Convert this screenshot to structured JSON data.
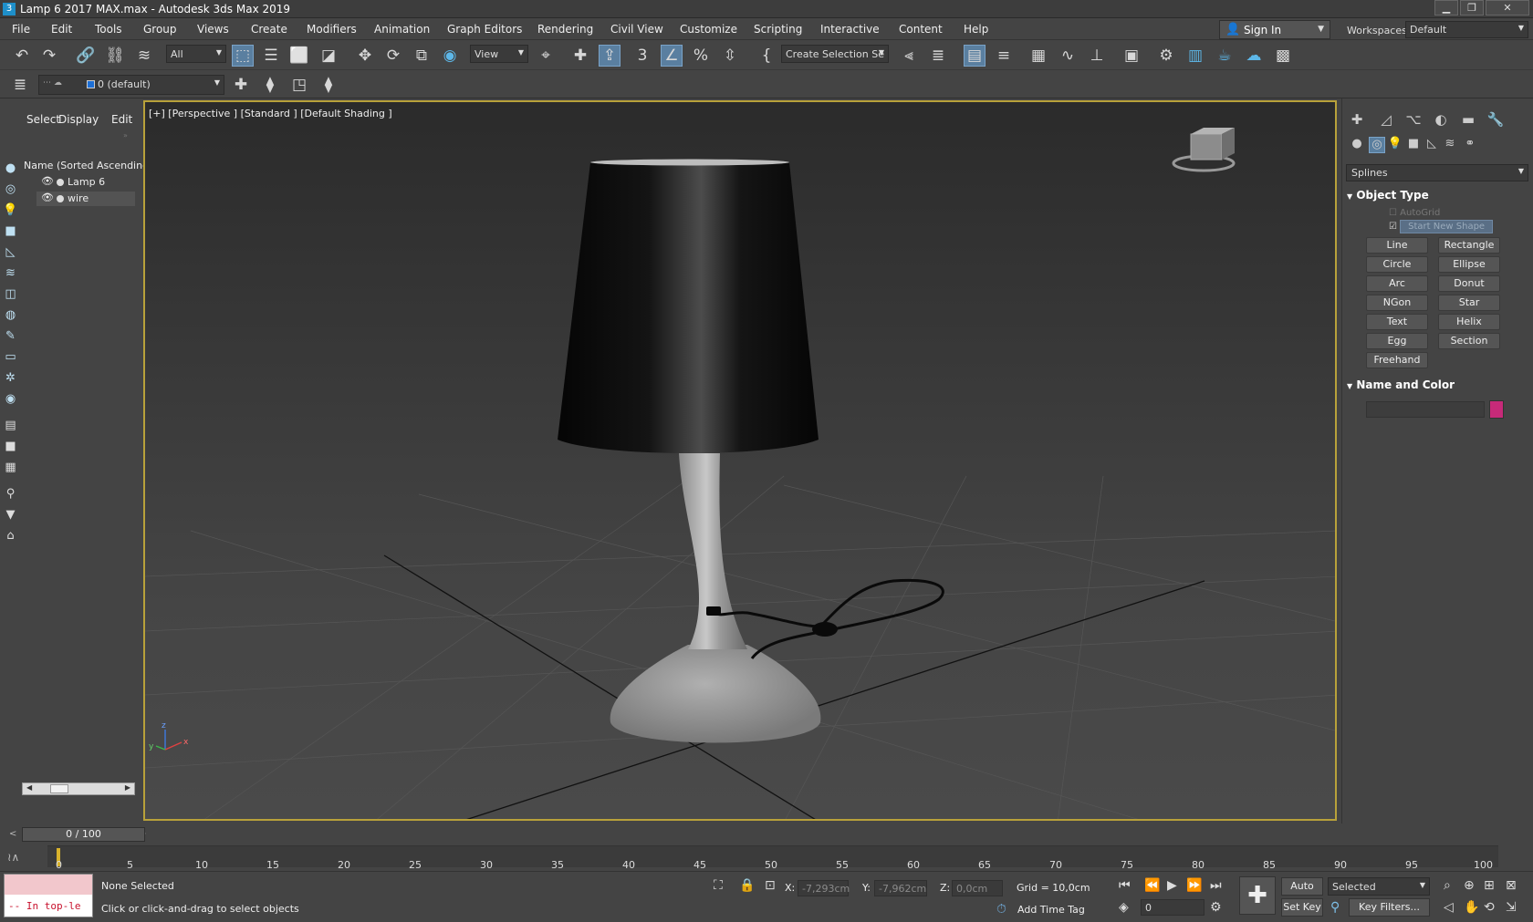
{
  "window": {
    "title": "Lamp 6 2017 MAX.max - Autodesk 3ds Max 2019",
    "app_icon": "3ds-max-icon",
    "controls": [
      "minimize",
      "restore",
      "close"
    ]
  },
  "menu": [
    "File",
    "Edit",
    "Tools",
    "Group",
    "Views",
    "Create",
    "Modifiers",
    "Animation",
    "Graph Editors",
    "Rendering",
    "Civil View",
    "Customize",
    "Scripting",
    "Interactive",
    "Content",
    "Help"
  ],
  "account": {
    "sign_in": "Sign In"
  },
  "workspaces": {
    "label": "Workspaces:",
    "value": "Default"
  },
  "toolbar": {
    "selection_filter": "All",
    "ref_coord": "View",
    "named_selection": "Create Selection Se"
  },
  "layer": {
    "current": "0 (default)"
  },
  "scene_explorer": {
    "tabs": [
      "Select",
      "Display",
      "Edit"
    ],
    "column_header": "Name (Sorted Ascending)",
    "items": [
      {
        "name": "Lamp 6"
      },
      {
        "name": "wire"
      }
    ]
  },
  "viewport": {
    "label": "[+] [Perspective ] [Standard ] [Default Shading ]",
    "border_color": "#b8a13a",
    "axis": [
      "z",
      "x",
      "y"
    ]
  },
  "command_panel": {
    "category": "Splines",
    "object_type_title": "Object Type",
    "autogrid": "AutoGrid",
    "start_new_shape": "Start New Shape",
    "buttons": [
      "Line",
      "Rectangle",
      "Circle",
      "Ellipse",
      "Arc",
      "Donut",
      "NGon",
      "Star",
      "Text",
      "Helix",
      "Egg",
      "Section",
      "Freehand"
    ],
    "name_color_title": "Name and Color",
    "object_color": "#c72a79"
  },
  "timeline": {
    "frame": "0 / 100",
    "ticks": [
      "0",
      "5",
      "10",
      "15",
      "20",
      "25",
      "30",
      "35",
      "40",
      "45",
      "50",
      "55",
      "60",
      "65",
      "70",
      "75",
      "80",
      "85",
      "90",
      "95",
      "100"
    ]
  },
  "status": {
    "maxscript_error": "-- In top-le",
    "selection": "None Selected",
    "prompt": "Click or click-and-drag to select objects",
    "x_label": "X:",
    "x": "-7,293cm",
    "y_label": "Y:",
    "y": "-7,962cm",
    "z_label": "Z:",
    "z": "0,0cm",
    "grid": "Grid = 10,0cm",
    "add_time_tag": "Add Time Tag",
    "auto_key": "Auto Key",
    "set_key": "Set Key",
    "key_mode": "Selected",
    "key_filters": "Key Filters...",
    "current_frame": "0"
  }
}
